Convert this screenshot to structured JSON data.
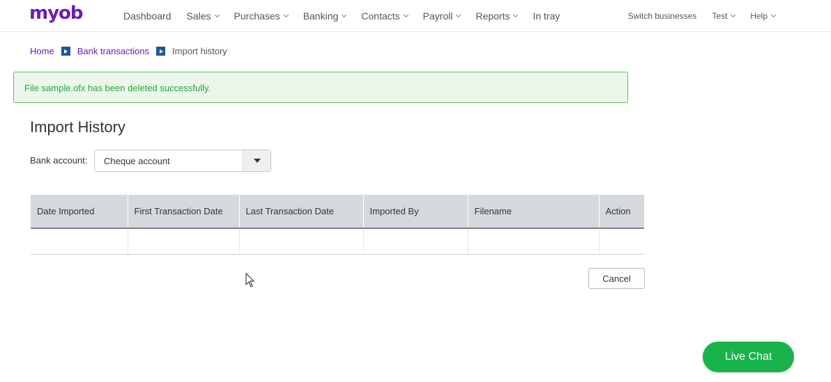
{
  "brand": {
    "logo_text": "myob",
    "color": "#6d1ab8"
  },
  "nav": {
    "items": [
      {
        "label": "Dashboard",
        "has_menu": false
      },
      {
        "label": "Sales",
        "has_menu": true
      },
      {
        "label": "Purchases",
        "has_menu": true
      },
      {
        "label": "Banking",
        "has_menu": true
      },
      {
        "label": "Contacts",
        "has_menu": true
      },
      {
        "label": "Payroll",
        "has_menu": true
      },
      {
        "label": "Reports",
        "has_menu": true
      },
      {
        "label": "In tray",
        "has_menu": false
      }
    ],
    "right": [
      {
        "label": "Switch businesses",
        "has_menu": false
      },
      {
        "label": "Test",
        "has_menu": true
      },
      {
        "label": "Help",
        "has_menu": true
      }
    ]
  },
  "breadcrumb": {
    "home": "Home",
    "bank_transactions": "Bank transactions",
    "current": "Import history"
  },
  "alert": {
    "message": "File sample.ofx has been deleted successfully.",
    "color": "#2ba334"
  },
  "page": {
    "title": "Import History"
  },
  "filter": {
    "label": "Bank account:",
    "selected": "Cheque account"
  },
  "table": {
    "columns": [
      "Date Imported",
      "First Transaction Date",
      "Last Transaction Date",
      "Imported By",
      "Filename",
      "Action"
    ],
    "rows": [
      [
        "",
        "",
        "",
        "",
        "",
        ""
      ]
    ]
  },
  "buttons": {
    "cancel": "Cancel",
    "live_chat": "Live Chat",
    "live_chat_color": "#18b34b"
  }
}
